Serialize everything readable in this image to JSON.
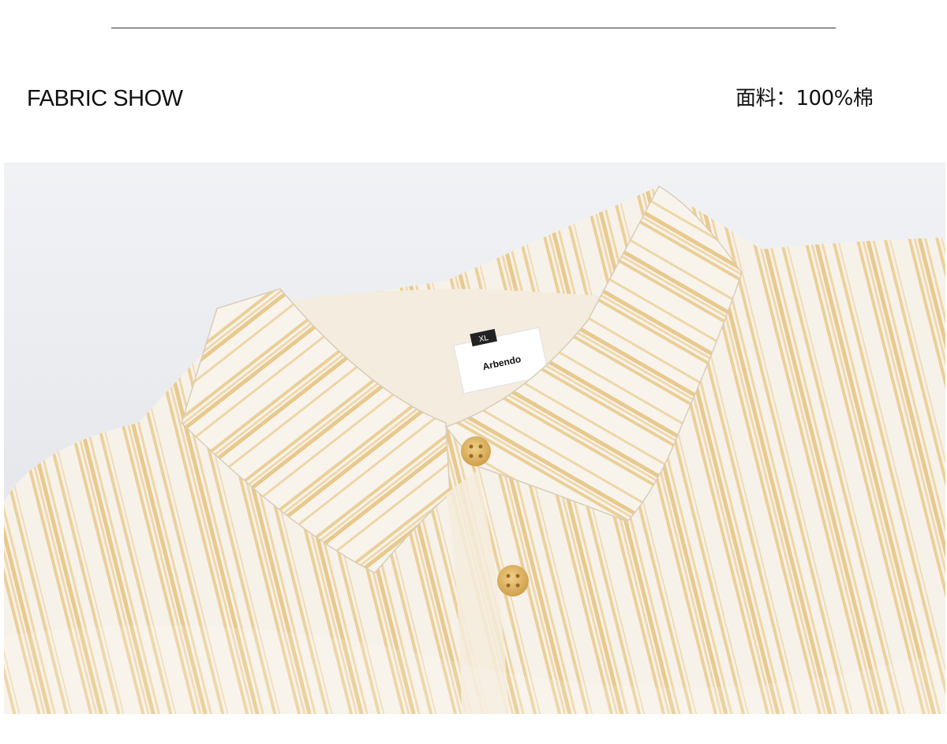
{
  "header": {
    "section_title": "FABRIC SHOW",
    "material_text": "面料：100%棉"
  },
  "photo": {
    "subject": "shirt-collar-closeup",
    "label_brand": "Arbendo",
    "label_size": "XL",
    "colors": {
      "background": "#e9ebef",
      "fabric_base": "#f6f1e8",
      "stripe": "#e8c98e",
      "button": "#e0b86a"
    }
  }
}
